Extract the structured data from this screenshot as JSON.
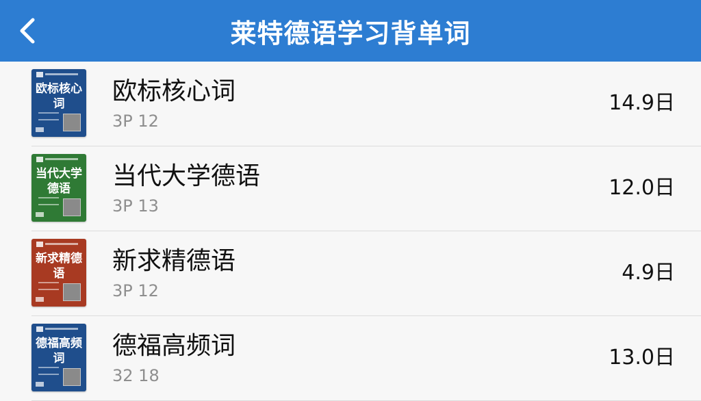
{
  "header": {
    "title": "莱特德语学习背单词",
    "back_icon": "chevron-left-icon",
    "color": "#2d7dd2"
  },
  "books": [
    {
      "cover_text": "欧标核心词",
      "cover_color": "#1f4e8c",
      "title": "欧标核心词",
      "subtitle": "3P 12",
      "value": "14.9日"
    },
    {
      "cover_text": "当代大学德语",
      "cover_color": "#2f7a35",
      "title": "当代大学德语",
      "subtitle": "3P 13",
      "value": "12.0日"
    },
    {
      "cover_text": "新求精德语",
      "cover_color": "#a83a22",
      "title": "新求精德语",
      "subtitle": "3P 12",
      "value": "4.9日"
    },
    {
      "cover_text": "德福高频词",
      "cover_color": "#1f4e8c",
      "title": "德福高频词",
      "subtitle": "32 18",
      "value": "13.0日"
    }
  ]
}
